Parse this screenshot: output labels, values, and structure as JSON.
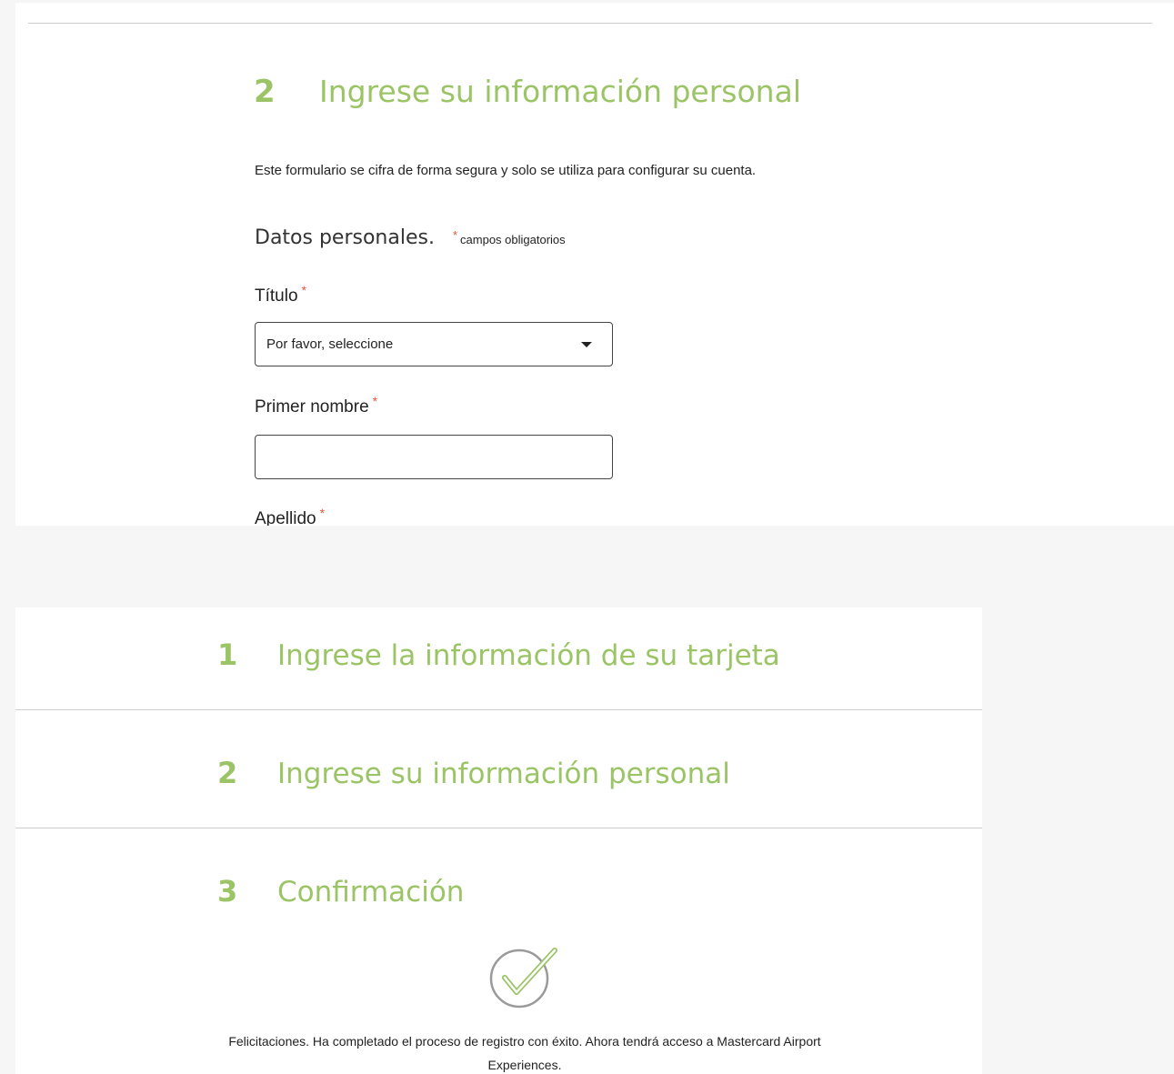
{
  "personal_step": {
    "number": "2",
    "title": "Ingrese su información personal",
    "intro": "Este formulario se cifra de forma segura y solo se utiliza para configurar su cuenta.",
    "section_title": "Datos personales.",
    "required_marker": "*",
    "required_note": "campos obligatorios",
    "fields": {
      "title_label": "Título",
      "title_select_value": "Por favor, seleccione",
      "first_name_label": "Primer nombre",
      "first_name_value": "",
      "last_name_label": "Apellido"
    }
  },
  "accordion": {
    "steps": [
      {
        "number": "1",
        "title": "Ingrese la información de su tarjeta"
      },
      {
        "number": "2",
        "title": "Ingrese su información personal"
      },
      {
        "number": "3",
        "title": "Confirmación"
      }
    ],
    "confirmation_message": "Felicitaciones. Ha completado el proceso de registro con éxito. Ahora tendrá acceso a Mastercard Airport Experiences."
  },
  "colors": {
    "accent_green": "#9bc466",
    "required_red": "#e8543a",
    "background": "#f6f6f6"
  },
  "icons": {
    "dropdown": "chevron-down-icon",
    "confirmation": "check-circle-icon"
  }
}
